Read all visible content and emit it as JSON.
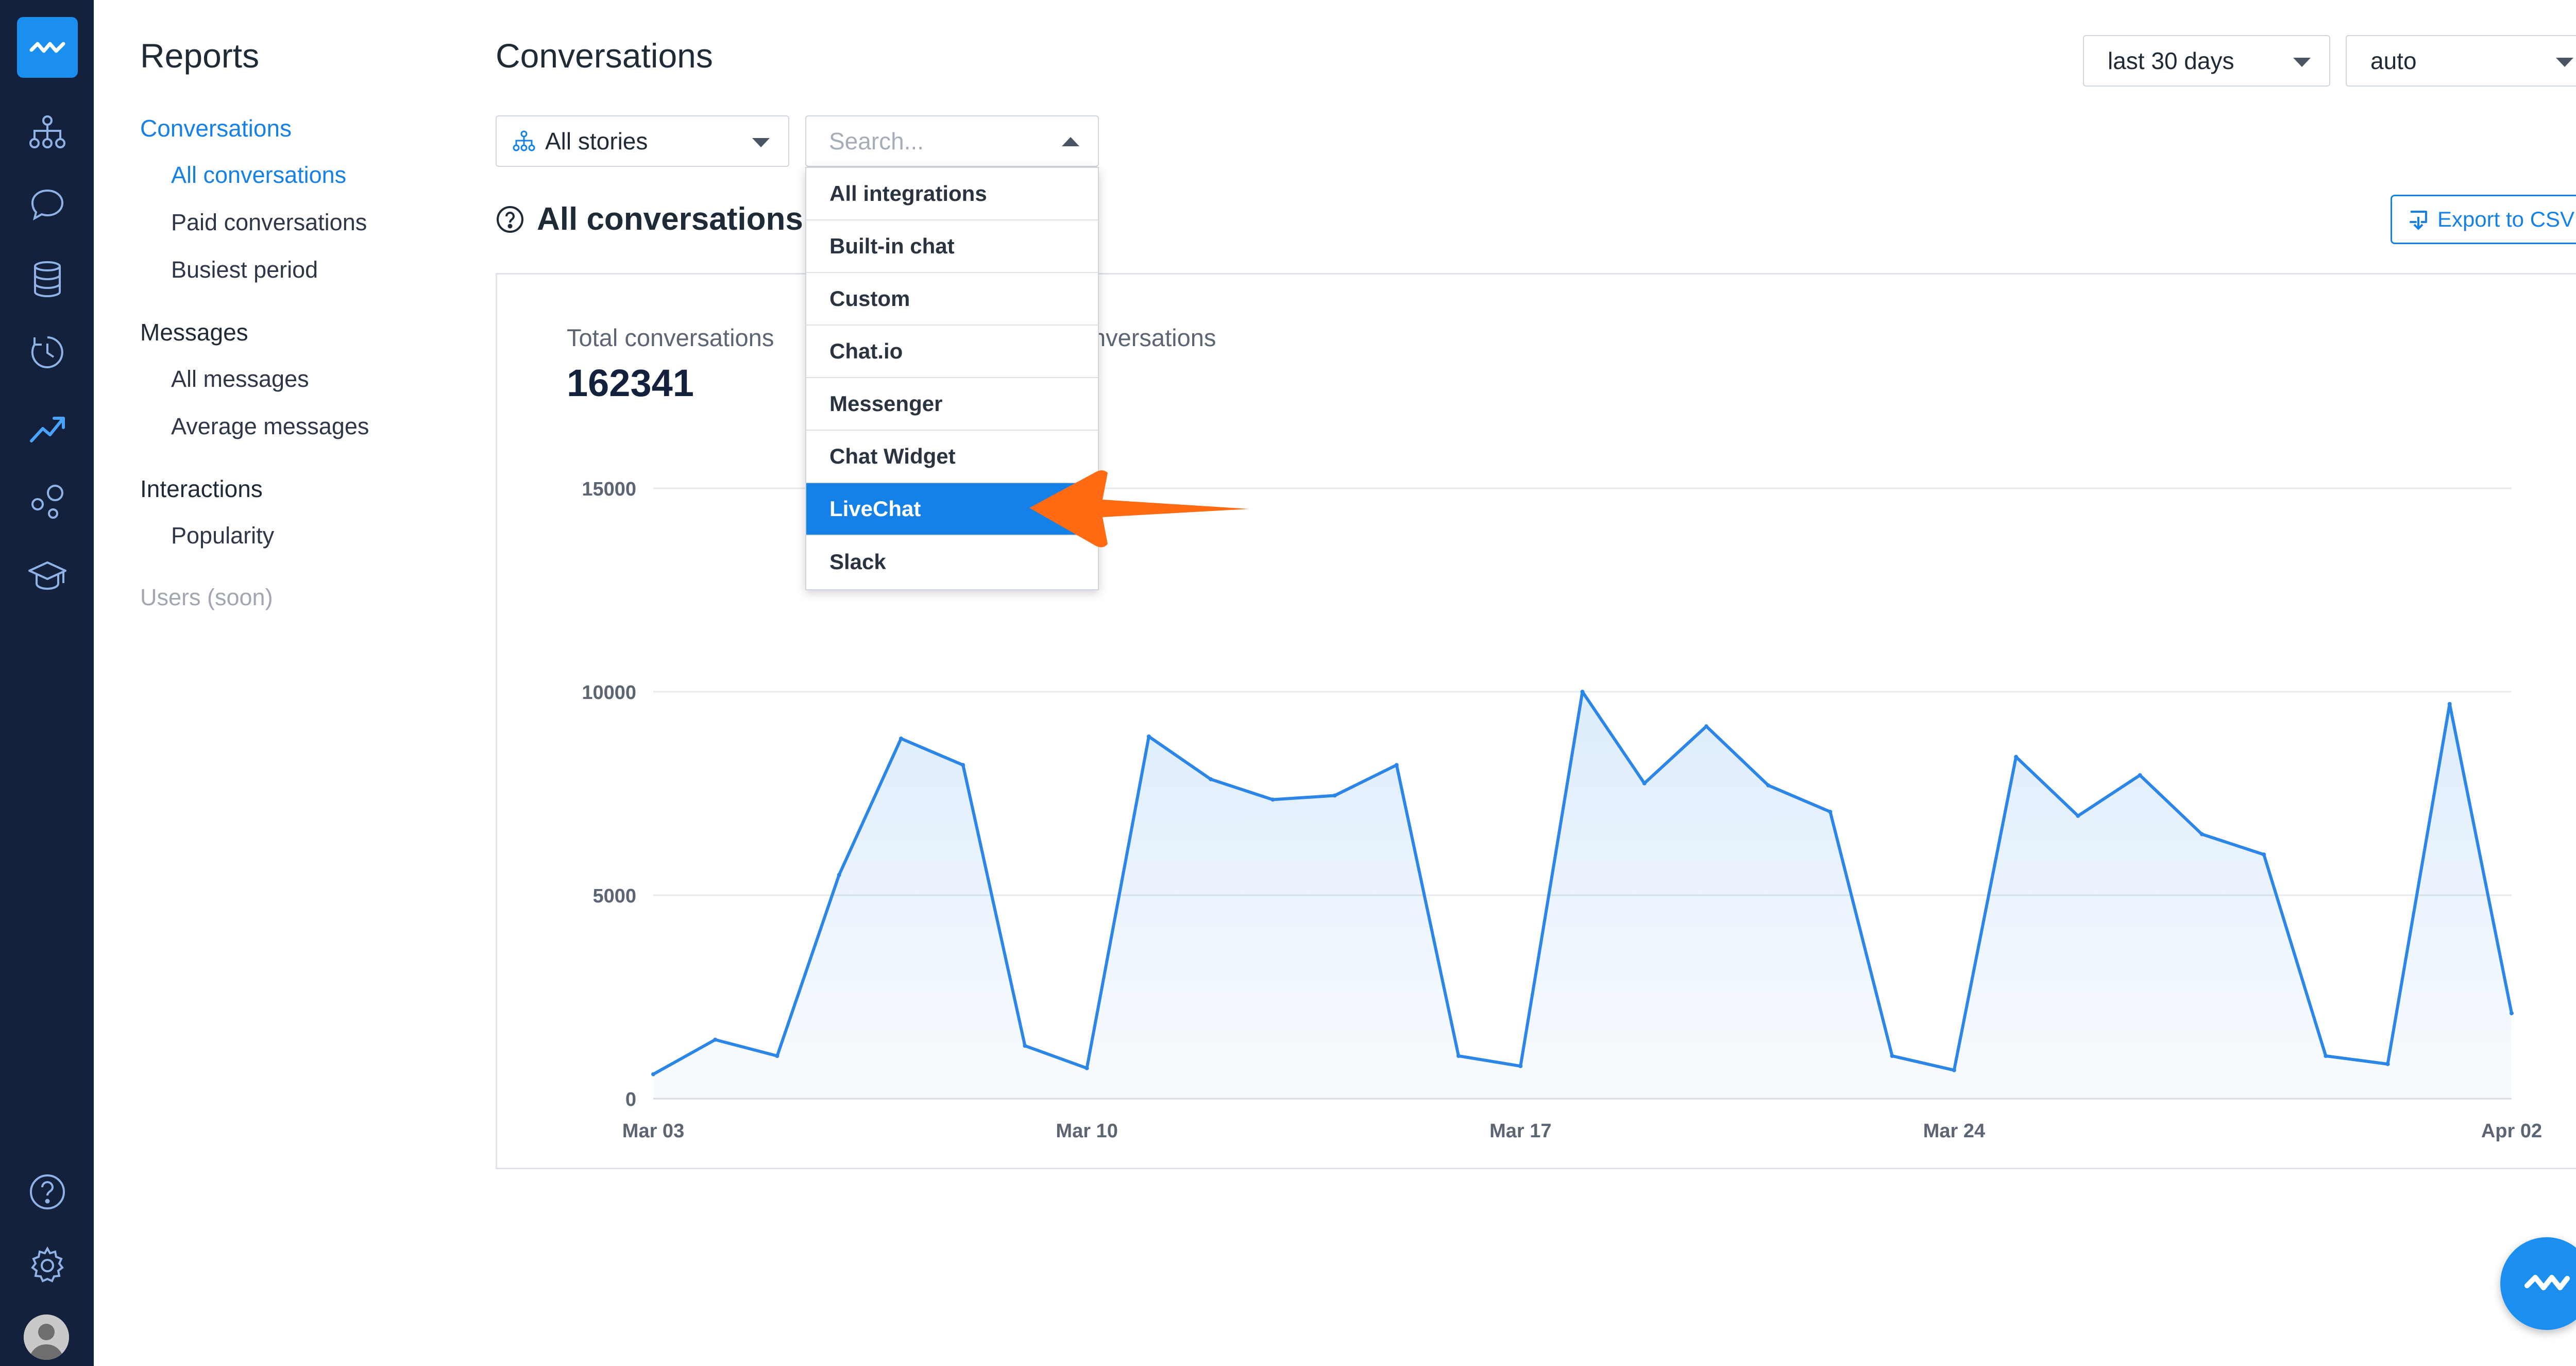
{
  "nav": {
    "title": "Reports",
    "sections": [
      {
        "label": "Conversations",
        "items": [
          "All conversations",
          "Paid conversations",
          "Busiest period"
        ]
      },
      {
        "label": "Messages",
        "items": [
          "All messages",
          "Average messages"
        ]
      },
      {
        "label": "Interactions",
        "items": [
          "Popularity"
        ]
      }
    ],
    "users": "Users (soon)"
  },
  "header": {
    "title": "Conversations",
    "range": "last 30 days",
    "granularity": "auto"
  },
  "filters": {
    "story": "All stories",
    "search_placeholder": "Search..."
  },
  "dropdown": {
    "options": [
      "All integrations",
      "Built-in chat",
      "Custom",
      "Chat.io",
      "Messenger",
      "Chat Widget",
      "LiveChat",
      "Slack"
    ],
    "selected": "LiveChat"
  },
  "section": {
    "title": "All conversations",
    "export_label": "Export to CSV"
  },
  "stats": {
    "total_label": "Total conversations",
    "total_value": "162341",
    "second_label": "nversations"
  },
  "colors": {
    "accent": "#1581e6",
    "rail": "#14213d",
    "line": "#2b86e8",
    "arrow": "#ff6a13"
  },
  "chart_data": {
    "type": "area",
    "x": [
      "Mar 03",
      "Mar 04",
      "Mar 05",
      "Mar 06",
      "Mar 07",
      "Mar 08",
      "Mar 09",
      "Mar 10",
      "Mar 11",
      "Mar 12",
      "Mar 13",
      "Mar 14",
      "Mar 15",
      "Mar 16",
      "Mar 17",
      "Mar 18",
      "Mar 19",
      "Mar 20",
      "Mar 21",
      "Mar 22",
      "Mar 23",
      "Mar 24",
      "Mar 25",
      "Mar 26",
      "Mar 27",
      "Mar 28",
      "Mar 29",
      "Mar 30",
      "Mar 31",
      "Apr 01",
      "Apr 02"
    ],
    "values": [
      600,
      1450,
      1050,
      5500,
      8850,
      8200,
      1300,
      750,
      8900,
      7850,
      7350,
      7450,
      8200,
      1050,
      800,
      10000,
      7750,
      9150,
      7700,
      7050,
      1050,
      700,
      8400,
      6950,
      7950,
      6500,
      6000,
      1050,
      850,
      9700,
      2100
    ],
    "x_ticks": [
      "Mar 03",
      "Mar 10",
      "Mar 17",
      "Mar 24",
      "Apr 02"
    ],
    "y_ticks": [
      "0",
      "5000",
      "10000",
      "15000"
    ],
    "ylim": [
      0,
      15000
    ],
    "grid": true
  }
}
